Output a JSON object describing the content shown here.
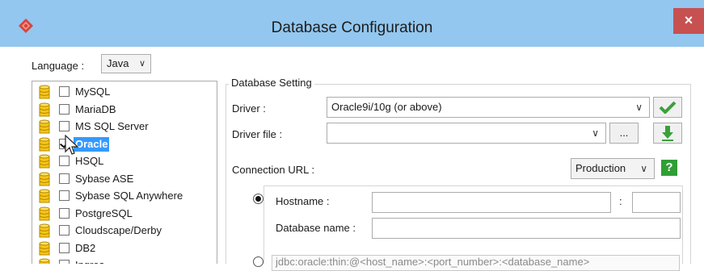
{
  "window": {
    "title": "Database Configuration",
    "close_glyph": "×"
  },
  "language": {
    "label": "Language :",
    "value": "Java"
  },
  "databases": [
    {
      "label": "MySQL",
      "checked": false
    },
    {
      "label": "MariaDB",
      "checked": false
    },
    {
      "label": "MS SQL Server",
      "checked": false
    },
    {
      "label": "Oracle",
      "checked": true
    },
    {
      "label": "HSQL",
      "checked": false
    },
    {
      "label": "Sybase ASE",
      "checked": false
    },
    {
      "label": "Sybase SQL Anywhere",
      "checked": false
    },
    {
      "label": "PostgreSQL",
      "checked": false
    },
    {
      "label": "Cloudscape/Derby",
      "checked": false
    },
    {
      "label": "DB2",
      "checked": false
    },
    {
      "label": "Ingres",
      "checked": false
    }
  ],
  "settings": {
    "group_title": "Database Setting",
    "driver_label": "Driver :",
    "driver_value": "Oracle9i/10g (or above)",
    "driver_file_label": "Driver file :",
    "driver_file_value": "",
    "browse_label": "...",
    "connection_url_label": "Connection URL :",
    "environment_value": "Production",
    "help_glyph": "?",
    "hostname_label": "Hostname :",
    "hostname_value": "",
    "port_separator": ":",
    "port_value": "",
    "database_name_label": "Database name :",
    "database_name_value": "",
    "url_template": "jdbc:oracle:thin:@<host_name>:<port_number>:<database_name>"
  },
  "colors": {
    "titlebar": "#93c7ef",
    "close": "#c75050",
    "selection": "#3399ff",
    "ok_green": "#3aa13a"
  }
}
